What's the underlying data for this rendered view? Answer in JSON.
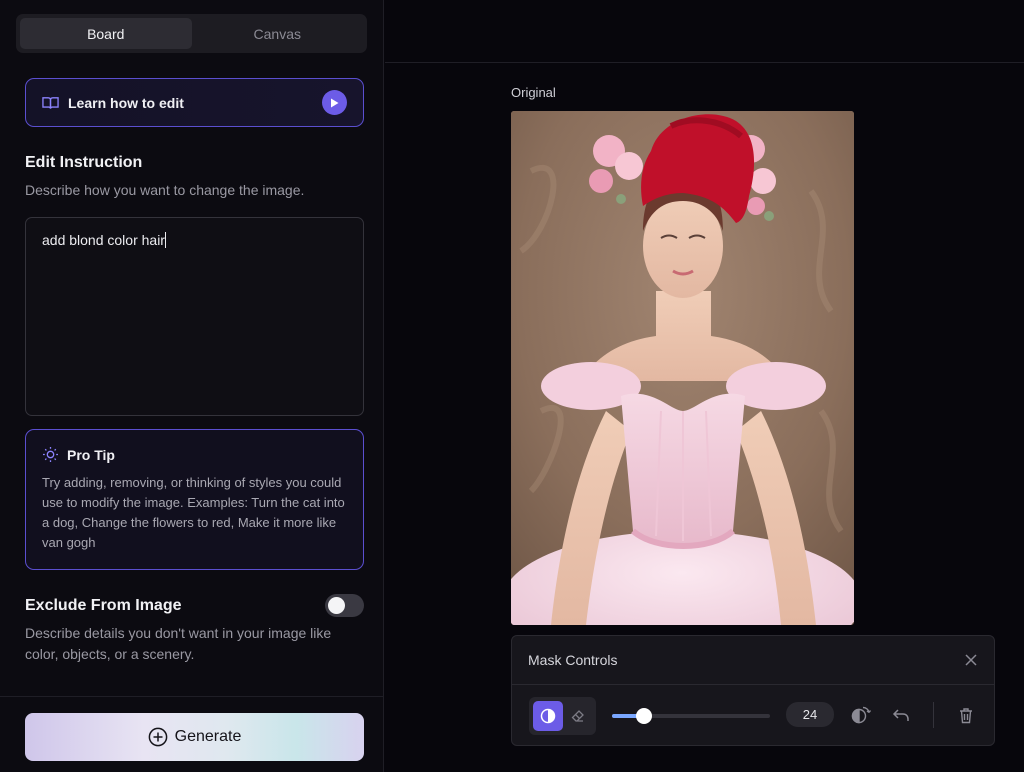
{
  "tabs": [
    {
      "label": "Board",
      "active": true
    },
    {
      "label": "Canvas",
      "active": false
    }
  ],
  "learn": {
    "label": "Learn how to edit",
    "icon": "book-icon"
  },
  "edit_instruction": {
    "title": "Edit Instruction",
    "description": "Describe how you want to change the image.",
    "value": "add blond color hair"
  },
  "pro_tip": {
    "title": "Pro Tip",
    "body": "Try adding, removing, or thinking of styles you could use to modify the image. Examples: Turn the cat into a dog, Change the flowers to red, Make it more like van gogh"
  },
  "exclude": {
    "title": "Exclude From Image",
    "description": "Describe details you don't want in your image like color, objects, or a scenery.",
    "enabled": false
  },
  "generate": {
    "label": "Generate"
  },
  "image": {
    "label": "Original"
  },
  "mask_controls": {
    "title": "Mask Controls",
    "brush_size": "24",
    "slider_fraction": 0.2
  },
  "colors": {
    "accent": "#6c5ce7",
    "slider": "#7aa7ff",
    "mask": "#c0102a"
  }
}
